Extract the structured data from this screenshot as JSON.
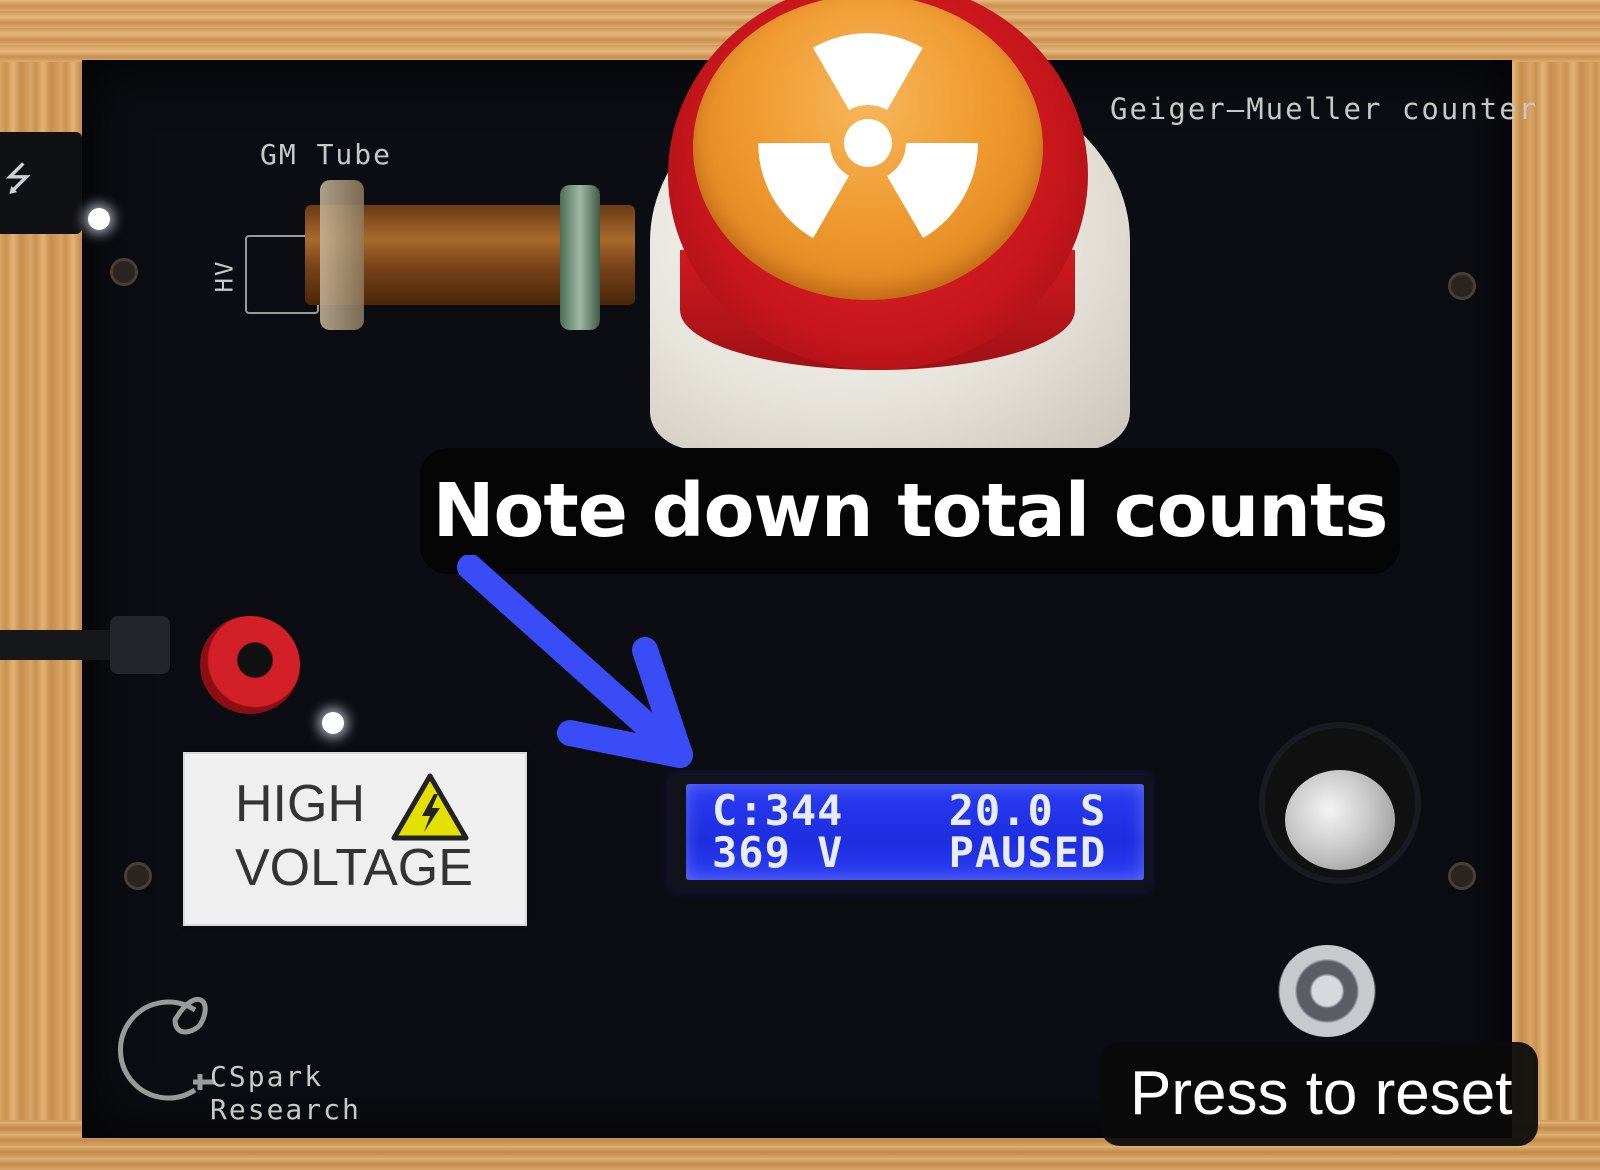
{
  "board": {
    "title": "Geiger–Mueller counter",
    "tube_label": "GM Tube",
    "hv_pin_label": "HV"
  },
  "warning_sticker": {
    "line1": "HIGH",
    "line2": "VOLTAGE"
  },
  "lcd": {
    "counts": "C:344",
    "time": "20.0 S",
    "voltage": "369 V",
    "state": "PAUSED"
  },
  "annotations": {
    "callout": "Note down total counts",
    "reset_hint": "Press to reset",
    "arrow_color": "#3a4cf5"
  },
  "logo": {
    "line1": "CSpark",
    "line2": "Research"
  },
  "icons": {
    "radiation": "radiation-trefoil-icon",
    "high_voltage": "lightning-warning-icon",
    "usb": "usb-icon"
  }
}
